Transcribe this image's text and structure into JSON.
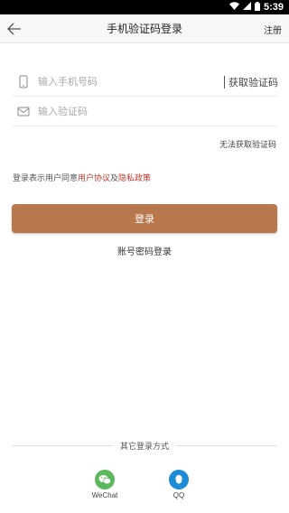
{
  "status_bar": {
    "time": "5:39",
    "icons": [
      "wifi-icon",
      "signal-icon",
      "battery-icon"
    ]
  },
  "header": {
    "title": "手机验证码登录",
    "register_label": "注册",
    "back_icon": "back-arrow-icon"
  },
  "phone_field": {
    "placeholder": "输入手机号码",
    "value": "",
    "icon": "phone-icon"
  },
  "code_field": {
    "placeholder": "输入验证码",
    "value": "",
    "icon": "envelope-icon"
  },
  "get_code_label": "获取验证码",
  "cant_get_code_label": "无法获取验证码",
  "agreement": {
    "prefix": "登录表示用户同意",
    "user_agreement": "用户协议",
    "and": "及",
    "privacy_policy": "隐私政策"
  },
  "login_button_label": "登录",
  "password_login_label": "账号密码登录",
  "other_login": {
    "label": "其它登录方式",
    "options": [
      {
        "name": "WeChat",
        "icon": "wechat-icon",
        "color": "#5cb85c"
      },
      {
        "name": "QQ",
        "icon": "qq-icon",
        "color": "#1e8bd6"
      }
    ]
  },
  "colors": {
    "accent": "#b8774c",
    "link": "#c0392b"
  }
}
